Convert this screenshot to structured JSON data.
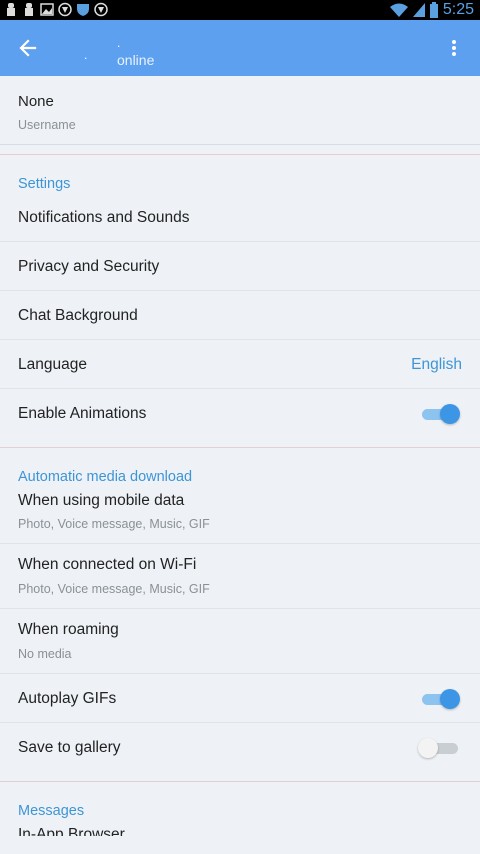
{
  "status_bar": {
    "time": "5:25",
    "icons": [
      "notification-icon",
      "notification-icon",
      "image-icon",
      "shield-icon",
      "vpn-icon",
      "android-icon",
      "wifi-icon",
      "signal-icon",
      "battery-icon"
    ]
  },
  "app_bar": {
    "title": ".",
    "title_extra": ".",
    "subtitle": "online",
    "back_icon": "arrow-back-icon",
    "menu_icon": "more-vert-icon"
  },
  "user": {
    "name": "None",
    "label": "Username"
  },
  "settings": {
    "header": "Settings",
    "items": [
      {
        "label": "Notifications and Sounds"
      },
      {
        "label": "Privacy and Security"
      },
      {
        "label": "Chat Background"
      },
      {
        "label": "Language",
        "value": "English"
      },
      {
        "label": "Enable Animations",
        "toggle": true
      }
    ]
  },
  "media": {
    "header": "Automatic media download",
    "items": [
      {
        "label": "When using mobile data",
        "sub": "Photo, Voice message, Music, GIF"
      },
      {
        "label": "When connected on Wi-Fi",
        "sub": "Photo, Voice message, Music, GIF"
      },
      {
        "label": "When roaming",
        "sub": "No media"
      },
      {
        "label": "Autoplay GIFs",
        "toggle": true
      },
      {
        "label": "Save to gallery",
        "toggle": false
      }
    ]
  },
  "messages": {
    "header": "Messages",
    "peek_label": "In-App Browser"
  },
  "colors": {
    "app_bar": "#5ea0f0",
    "accent": "#3d95d6",
    "background": "#eef2f6"
  }
}
